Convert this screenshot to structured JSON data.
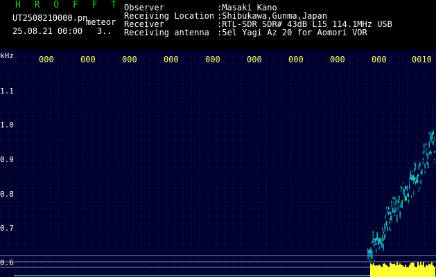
{
  "header": {
    "app_title": "H R O F F T",
    "file_name": "UT2508210000.pn",
    "mode": "meteor",
    "datetime": "25.08.21 00:00",
    "count": "3..",
    "rows": [
      {
        "label": "Observer",
        "value": ":Masaki Kano"
      },
      {
        "label": "Receiving Location",
        "value": ":Shibukawa,Gunma,Japan"
      },
      {
        "label": "Receiver",
        "value": ":RTL-SDR SDR# 43dB L15 114.1MHz USB"
      },
      {
        "label": "Receiving antenna",
        "value": ":5el Yagi Az 20 for Aomori VOR"
      }
    ]
  },
  "plot": {
    "unit": "kHz",
    "y_ticks": [
      "1.1",
      "1.0",
      "0.9",
      "0.8",
      "0.7",
      "0.6"
    ],
    "time_ticks": [
      "000",
      "000",
      "000",
      "000",
      "000",
      "000",
      "000",
      "000",
      "000",
      "0010"
    ],
    "colors": {
      "background": "#02022e",
      "grid": "#1c2a8c",
      "signal": "#19c8e6",
      "activity": "#ffff33",
      "tick_label": "#ffff66"
    }
  }
}
